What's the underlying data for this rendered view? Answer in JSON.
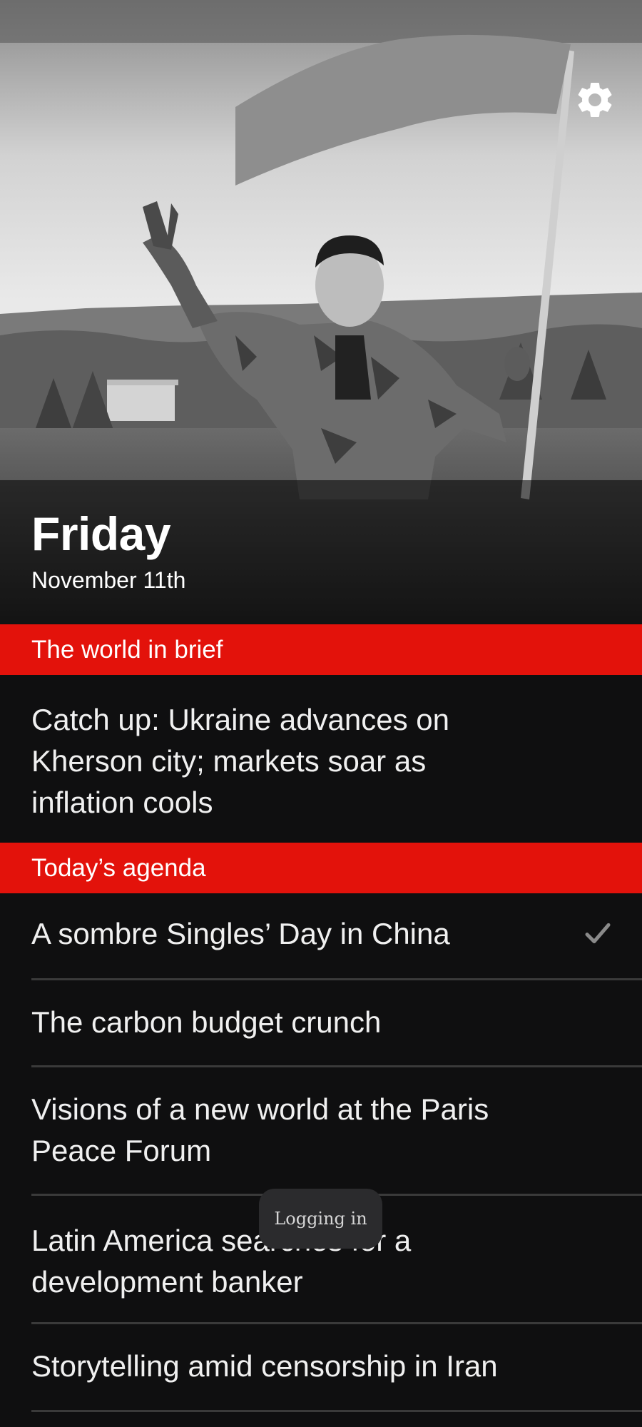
{
  "header": {
    "day": "Friday",
    "date": "November 11th",
    "settings_icon": "gear-icon"
  },
  "sections": {
    "brief_label": "The world in brief",
    "agenda_label": "Today’s agenda"
  },
  "brief": {
    "catch_up": "Catch up: Ukraine advances on Kherson city; markets soar as inflation cools"
  },
  "agenda": {
    "items": [
      {
        "title": "A sombre Singles’ Day in China",
        "read": true
      },
      {
        "title": "The carbon budget crunch",
        "read": false
      },
      {
        "title": "Visions of a new world at the Paris Peace Forum",
        "read": false
      },
      {
        "title": "Latin America searches for a development banker",
        "read": false
      },
      {
        "title": "Storytelling amid censorship in Iran",
        "read": false
      }
    ]
  },
  "toast": {
    "text": "Logging in"
  },
  "colors": {
    "accent": "#e3120b",
    "background": "#0f0f10",
    "divider": "#3a3a3a"
  }
}
